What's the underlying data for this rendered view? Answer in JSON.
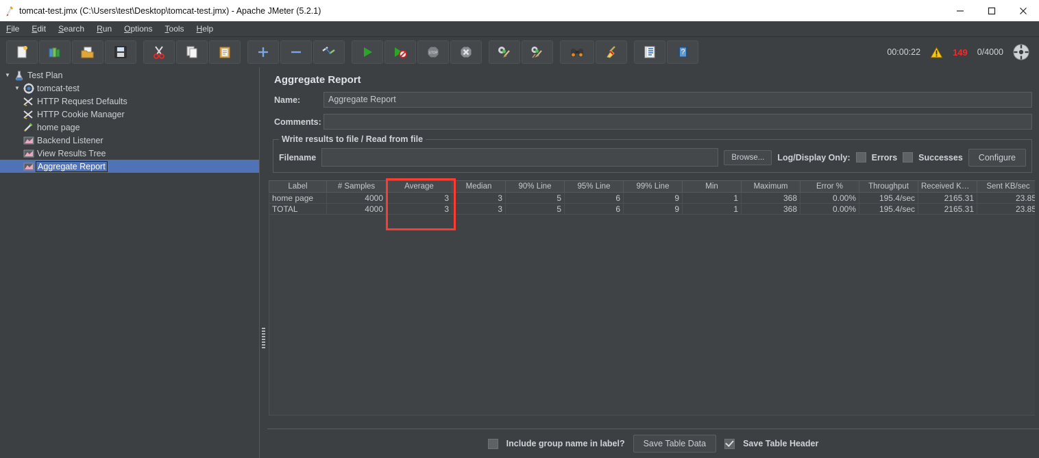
{
  "window": {
    "title": "tomcat-test.jmx (C:\\Users\\test\\Desktop\\tomcat-test.jmx) - Apache JMeter (5.2.1)",
    "app_icon": "jmeter-feather-icon",
    "minimize_label": "—",
    "maximize_label": "□",
    "close_label": "✕"
  },
  "menu": {
    "items": [
      {
        "label": "File",
        "mnemonic": "F"
      },
      {
        "label": "Edit",
        "mnemonic": "E"
      },
      {
        "label": "Search",
        "mnemonic": "S"
      },
      {
        "label": "Run",
        "mnemonic": "R"
      },
      {
        "label": "Options",
        "mnemonic": "O"
      },
      {
        "label": "Tools",
        "mnemonic": "T"
      },
      {
        "label": "Help",
        "mnemonic": "H"
      }
    ]
  },
  "toolbar": {
    "buttons": [
      {
        "name": "new-button",
        "icon": "new-document-icon"
      },
      {
        "name": "templates-button",
        "icon": "templates-books-icon"
      },
      {
        "name": "open-button",
        "icon": "open-folder-icon"
      },
      {
        "name": "save-button",
        "icon": "save-floppy-icon"
      },
      {
        "name": "cut-button",
        "icon": "scissors-icon"
      },
      {
        "name": "copy-button",
        "icon": "copy-pages-icon"
      },
      {
        "name": "paste-button",
        "icon": "clipboard-icon"
      },
      {
        "name": "expand-button",
        "icon": "plus-icon"
      },
      {
        "name": "collapse-button",
        "icon": "minus-icon"
      },
      {
        "name": "toggle-button",
        "icon": "toggle-pencils-icon"
      },
      {
        "name": "start-button",
        "icon": "green-play-icon"
      },
      {
        "name": "start-no-pauses-button",
        "icon": "play-no-pauses-icon"
      },
      {
        "name": "stop-button",
        "icon": "stop-sign-icon"
      },
      {
        "name": "shutdown-button",
        "icon": "shutdown-x-icon"
      },
      {
        "name": "clear-button",
        "icon": "gear-broom-icon"
      },
      {
        "name": "clear-all-button",
        "icon": "gear-broom-all-icon"
      },
      {
        "name": "search-button",
        "icon": "binoculars-icon"
      },
      {
        "name": "reset-search-button",
        "icon": "broom-icon"
      },
      {
        "name": "function-helper-button",
        "icon": "notebook-list-icon"
      },
      {
        "name": "help-button",
        "icon": "blue-question-book-icon"
      }
    ],
    "elapsed_time": "00:00:22",
    "warning_icon": "warning-triangle-icon",
    "warning_count": "149",
    "thread_ratio": "0/4000",
    "remote_icon": "connection-dots-icon"
  },
  "tree": {
    "items": [
      {
        "label": "Test Plan",
        "icon": "test-plan-icon",
        "indent": 0,
        "twisty": "▼",
        "selected": false
      },
      {
        "label": "tomcat-test",
        "icon": "thread-group-gear-icon",
        "indent": 1,
        "twisty": "▼",
        "selected": false
      },
      {
        "label": "HTTP Request Defaults",
        "icon": "config-wrench-icon",
        "indent": 2,
        "twisty": "",
        "selected": false
      },
      {
        "label": "HTTP Cookie Manager",
        "icon": "config-wrench-icon",
        "indent": 2,
        "twisty": "",
        "selected": false
      },
      {
        "label": "home page",
        "icon": "sampler-pencil-icon",
        "indent": 2,
        "twisty": "",
        "selected": false
      },
      {
        "label": "Backend Listener",
        "icon": "listener-chart-icon",
        "indent": 2,
        "twisty": "",
        "selected": false
      },
      {
        "label": "View Results Tree",
        "icon": "listener-chart-icon",
        "indent": 2,
        "twisty": "",
        "selected": false
      },
      {
        "label": "Aggregate Report",
        "icon": "listener-chart-icon",
        "indent": 2,
        "twisty": "",
        "selected": true
      }
    ]
  },
  "main": {
    "panel_title": "Aggregate Report",
    "name_label": "Name:",
    "name_value": "Aggregate Report",
    "comments_label": "Comments:",
    "comments_value": "",
    "comments_placeholder": "",
    "group": {
      "legend": "Write results to file / Read from file",
      "filename_label": "Filename",
      "filename_value": "",
      "browse_label": "Browse...",
      "log_display_label": "Log/Display Only:",
      "errors_label": "Errors",
      "errors_checked": false,
      "successes_label": "Successes",
      "successes_checked": false,
      "configure_label": "Configure"
    }
  },
  "table": {
    "columns": [
      "Label",
      "# Samples",
      "Average",
      "Median",
      "90% Line",
      "95% Line",
      "99% Line",
      "Min",
      "Maximum",
      "Error %",
      "Throughput",
      "Received KB/...",
      "Sent KB/sec"
    ],
    "rows": [
      [
        "home page",
        "4000",
        "3",
        "3",
        "5",
        "6",
        "9",
        "1",
        "368",
        "0.00%",
        "195.4/sec",
        "2165.31",
        "23.85"
      ],
      [
        "TOTAL",
        "4000",
        "3",
        "3",
        "5",
        "6",
        "9",
        "1",
        "368",
        "0.00%",
        "195.4/sec",
        "2165.31",
        "23.85"
      ]
    ],
    "highlight": {
      "column": "Average",
      "color": "#ff3b30"
    }
  },
  "footer": {
    "include_group_label": "Include group name in label?",
    "include_group_checked": false,
    "save_table_data_label": "Save Table Data",
    "save_table_header_label": "Save Table Header",
    "save_table_header_checked": true
  },
  "colors": {
    "window_bg": "#3c4043",
    "titlebar_bg": "#ffffff",
    "selection_blue": "#5073b8",
    "accent_red": "#ff3b30",
    "warning_red": "#ef2b2b",
    "text": "#c8ccd0"
  }
}
